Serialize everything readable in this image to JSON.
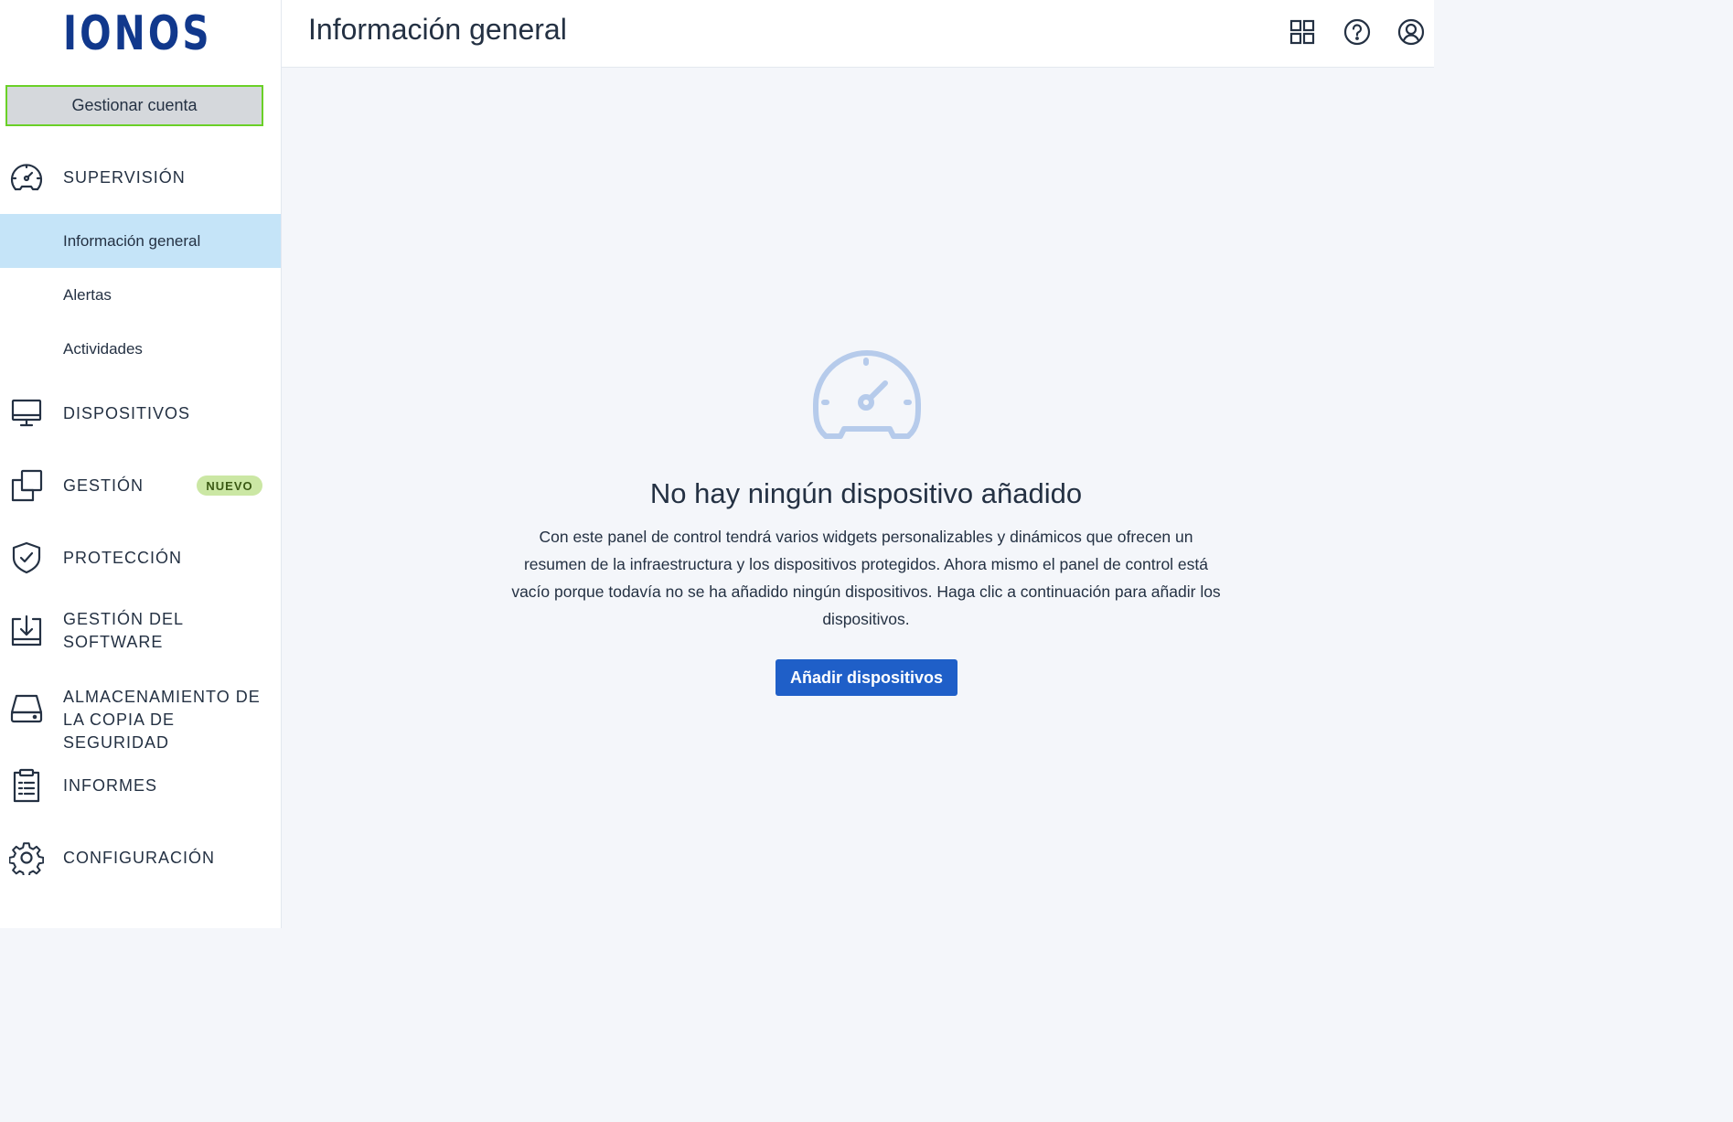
{
  "brand": {
    "logo_text": "IONOS"
  },
  "sidebar": {
    "manage_account": "Gestionar cuenta",
    "sections": [
      {
        "label": "SUPERVISIÓN",
        "icon": "speedometer-icon"
      },
      {
        "label": "DISPOSITIVOS",
        "icon": "monitor-icon"
      },
      {
        "label": "GESTIÓN",
        "icon": "copy-squares-icon",
        "badge": "NUEVO"
      },
      {
        "label": "PROTECCIÓN",
        "icon": "shield-check-icon"
      },
      {
        "label": "GESTIÓN DEL SOFTWARE",
        "icon": "download-box-icon"
      },
      {
        "label_line1": "ALMACENAMIENTO DE",
        "label_line2": "LA COPIA DE SEGURIDAD",
        "icon": "hard-drive-icon"
      },
      {
        "label": "INFORMES",
        "icon": "clipboard-icon"
      },
      {
        "label": "CONFIGURACIÓN",
        "icon": "gear-icon"
      }
    ],
    "supervision_items": [
      {
        "label": "Información general",
        "active": true
      },
      {
        "label": "Alertas"
      },
      {
        "label": "Actividades"
      }
    ]
  },
  "header": {
    "title": "Información general",
    "icons": [
      "grid-icon",
      "help-icon",
      "user-icon"
    ]
  },
  "empty_state": {
    "icon": "speedometer-icon",
    "title": "No hay ningún dispositivo añadido",
    "description": "Con este panel de control tendrá varios widgets personalizables y dinámicos que ofrecen un resumen de la infraestructura y los dispositivos protegidos. Ahora mismo el panel de control está vacío porque todavía no se ha añadido ningún dispositivos. Haga clic a continuación para añadir los dispositivos.",
    "button": "Añadir dispositivos"
  },
  "colors": {
    "brand": "#11388c",
    "active_item_bg": "#c5e4f8",
    "highlight_border": "#6ad027",
    "primary_button": "#1f5fc8",
    "badge_bg": "#cbe7a4",
    "illustration": "#b6cbeb"
  }
}
